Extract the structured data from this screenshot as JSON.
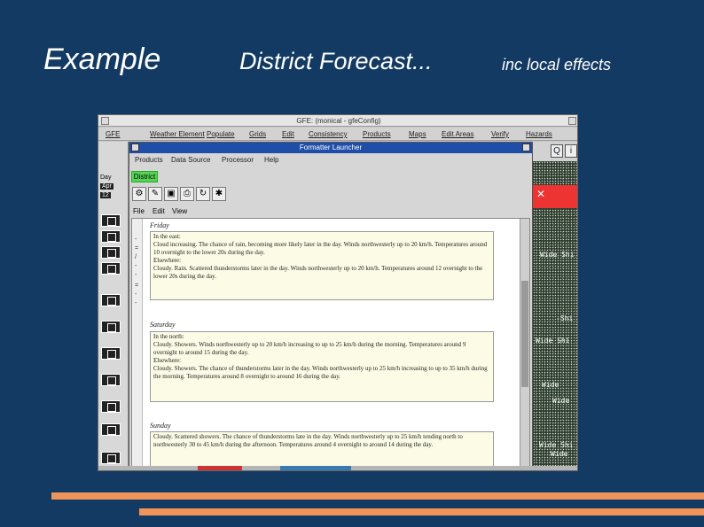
{
  "slide": {
    "title_example": "Example",
    "title_main": "District Forecast...",
    "title_sub": "inc local effects",
    "accent_color": "#f0955a",
    "background_color": "#123a63"
  },
  "gfe": {
    "window_title": "GFE: (monical - gfeConfig)",
    "menu": [
      "GFE",
      "Weather Element",
      "Populate",
      "Grids",
      "Edit",
      "Consistency",
      "Products",
      "Maps",
      "Edit Areas",
      "Verify",
      "Hazards"
    ],
    "left_labels": [
      "Day",
      "Apr",
      "12"
    ],
    "map_labels": [
      "Wide Shi",
      "-Shi",
      "Wide Shi",
      "Wide",
      "Wide",
      "Wide Shi",
      "Wide"
    ]
  },
  "launcher": {
    "title": "Formatter Launcher",
    "menu": [
      "Products",
      "Data Source",
      "Processor",
      "Help"
    ],
    "district_tab": "District",
    "editor_menu": [
      "File",
      "Edit",
      "View"
    ],
    "days": [
      {
        "name": "Friday",
        "text": "In the east:\nCloud increasing. The chance of rain, becoming more likely later in the day. Winds northwesterly up to 20 km/h. Temperatures around 10 overnight to the lower 20s during the day.\nElsewhere:\nCloudy. Rain. Scattered thunderstorms later in the day. Winds northwesterly up to 20 km/h. Temperatures around 12 overnight to the lower 20s during the day."
      },
      {
        "name": "Saturday",
        "text": "In the north:\nCloudy. Showers. Winds northwesterly up to 20 km/h increasing to up to 25 km/h during the morning. Temperatures around 9 overnight to around 15 during the day.\nElsewhere:\nCloudy. Showers. The chance of thunderstorms later in the day. Winds northwesterly up to 25 km/h increasing to up to 35 km/h during the morning. Temperatures around 8 overnight to around 16 during the day."
      },
      {
        "name": "Sunday",
        "text": "Cloudy. Scattered showers. The chance of thunderstorms late in the day. Winds northwesterly up to 25 km/h tending north to northwesterly 30 to 45 km/h during the afternoon. Temperatures around 4 overnight to around 14 during the day."
      }
    ]
  }
}
